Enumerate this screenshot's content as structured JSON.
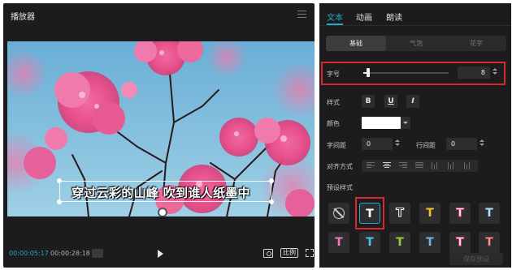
{
  "player": {
    "title": "播放器",
    "subtitle_text": "穿过云彩的山峰 吹到谁人纸墨中",
    "current_time": "00:00:05:17",
    "total_time": "00:00:28:18",
    "ratio_label": "比例"
  },
  "panel": {
    "tabs": [
      {
        "label": "文本",
        "active": true
      },
      {
        "label": "动画",
        "active": false
      },
      {
        "label": "朗读",
        "active": false
      }
    ],
    "subtabs": [
      {
        "label": "基础",
        "active": true
      },
      {
        "label": "气泡",
        "active": false
      },
      {
        "label": "花字",
        "active": false
      }
    ],
    "font_size": {
      "label": "字号",
      "value": "8",
      "slider_fraction": 0.06
    },
    "style": {
      "label": "样式",
      "bold": "B",
      "underline": "U",
      "italic": "I"
    },
    "color": {
      "label": "颜色",
      "value": "#ffffff"
    },
    "letter_spacing": {
      "label": "字间距",
      "value": "0"
    },
    "line_spacing": {
      "label": "行间距",
      "value": "0"
    },
    "align": {
      "label": "对齐方式"
    },
    "presets": {
      "label": "预设样式",
      "row1": [
        {
          "kind": "none",
          "color": ""
        },
        {
          "kind": "T",
          "color": "#ffffff",
          "selected": true
        },
        {
          "kind": "T",
          "color": "#ffffff",
          "outline": true
        },
        {
          "kind": "T",
          "color": "#f2c230"
        },
        {
          "kind": "T",
          "color": "#ffffff",
          "stroke": "#e0417a"
        },
        {
          "kind": "T",
          "color": "#aee0f2"
        }
      ],
      "row2": [
        {
          "kind": "T",
          "color": "#f27ab4"
        },
        {
          "kind": "T",
          "color": "#4fc3e8"
        },
        {
          "kind": "T",
          "color": "#9acb3c"
        },
        {
          "kind": "T",
          "color": "#6fb4e8"
        },
        {
          "kind": "T",
          "color": "#ffffff",
          "stroke": "#e0417a"
        },
        {
          "kind": "T",
          "color": "#f2b8a8",
          "stroke": "#9a3a3a"
        }
      ],
      "glyph": "T"
    },
    "save_preset_label": "保存预设"
  },
  "colors": {
    "accent": "#2aa6c6",
    "highlight": "#d7292c",
    "panel_bg": "#1c1c1e"
  }
}
